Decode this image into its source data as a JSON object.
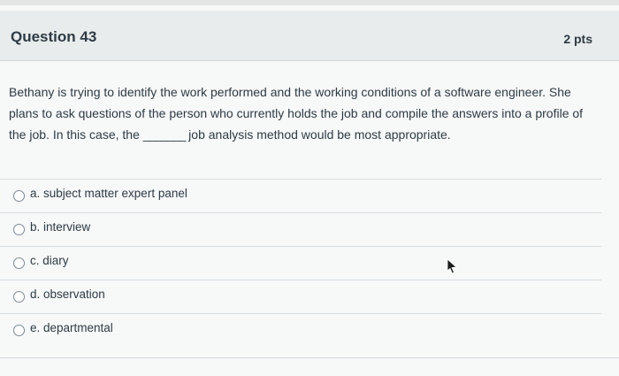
{
  "question": {
    "title": "Question 43",
    "points": "2 pts",
    "text_part1": "Bethany is trying to identify the work performed and the working conditions of a software engineer. She plans to ask questions of the person who currently holds the job and compile the answers into a profile of the job. In this case, the ",
    "blank": "_______",
    "text_part2": " job analysis method would be most appropriate."
  },
  "answers": [
    {
      "label": "a. subject matter expert panel",
      "selected": false
    },
    {
      "label": "b. interview",
      "selected": false
    },
    {
      "label": "c. diary",
      "selected": false
    },
    {
      "label": "d. observation",
      "selected": false
    },
    {
      "label": "e. departmental",
      "selected": false
    }
  ],
  "icons": {
    "cursor": "mouse-pointer-icon"
  },
  "colors": {
    "text": "#2d3b45",
    "header_bg": "#e9ecec",
    "page_bg": "#f7f8f8"
  }
}
